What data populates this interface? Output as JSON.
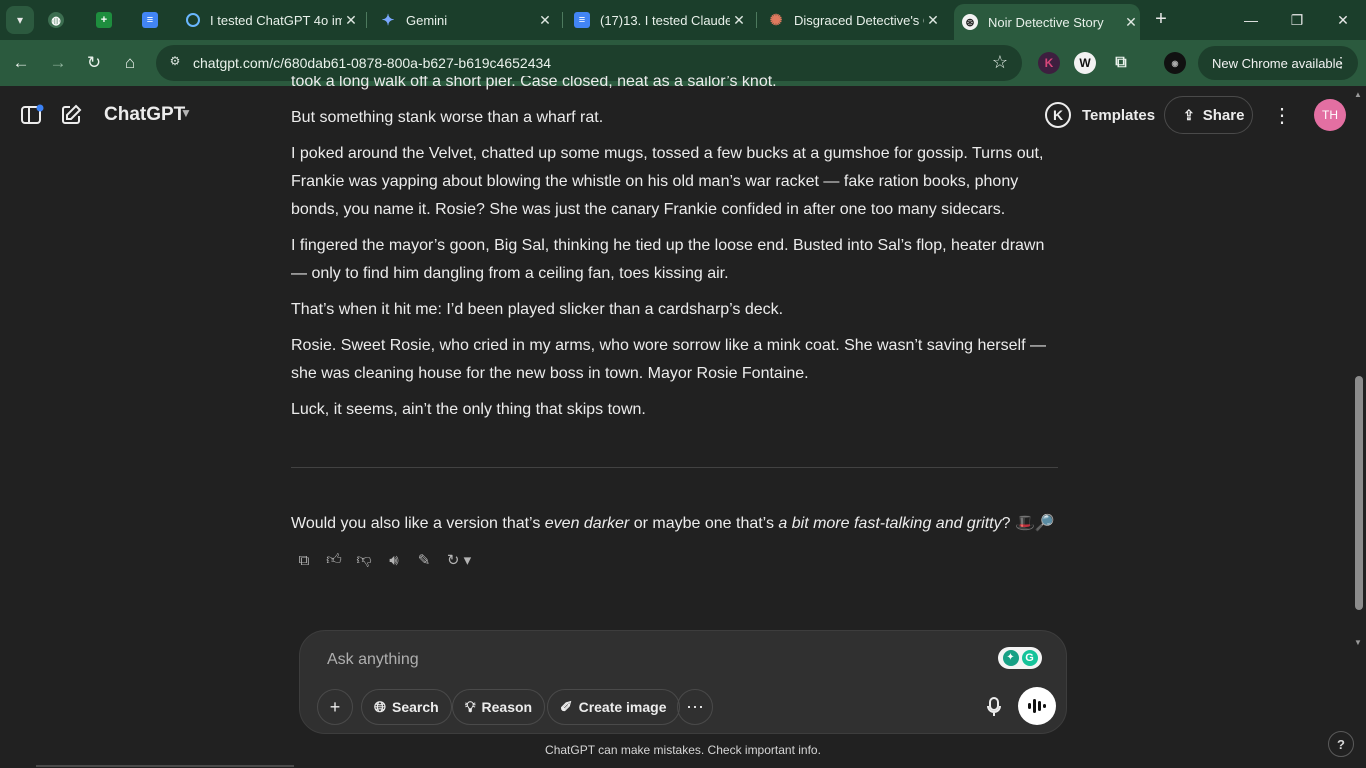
{
  "browser": {
    "tabs": [
      {
        "title": "",
        "favicon": "globe-icon"
      },
      {
        "title": "",
        "favicon": "sheets-icon"
      },
      {
        "title": "",
        "favicon": "docs-icon"
      },
      {
        "title": "I tested ChatGPT 4o im",
        "favicon": "refresh-favicon"
      },
      {
        "title": "Gemini",
        "favicon": "gemini-icon"
      },
      {
        "title": "(17)13. I tested Claude",
        "favicon": "docs-icon"
      },
      {
        "title": "Disgraced Detective's C",
        "favicon": "claude-icon"
      },
      {
        "title": "Noir Detective Story",
        "favicon": "chatgpt-icon"
      }
    ],
    "url": "chatgpt.com/c/680dab61-0878-800a-b627-b619c4652434",
    "update_label": "New Chrome available",
    "colors": {
      "frame": "#1b3e2b",
      "toolbar": "#2b5a3e"
    }
  },
  "header": {
    "model": "ChatGPT",
    "templates_badge": "K",
    "templates_label": "Templates",
    "share_label": "Share",
    "avatar_initials": "TH"
  },
  "conversation": {
    "cut_line": "took a long walk off a short pier. Case closed, neat as a sailor’s knot.",
    "paragraphs": [
      "But something stank worse than a wharf rat.",
      "I poked around the Velvet, chatted up some mugs, tossed a few bucks at a gumshoe for gossip. Turns out, Frankie was yapping about blowing the whistle on his old man’s war racket — fake ration books, phony bonds, you name it. Rosie? She was just the canary Frankie confided in after one too many sidecars.",
      "I fingered the mayor’s goon, Big Sal, thinking he tied up the loose end. Busted into Sal’s flop, heater drawn — only to find him dangling from a ceiling fan, toes kissing air.",
      "That’s when it hit me: I’d been played slicker than a cardsharp’s deck.",
      "Rosie. Sweet Rosie, who cried in my arms, who wore sorrow like a mink coat. She wasn’t saving herself — she was cleaning house for the new boss in town. Mayor Rosie Fontaine.",
      "Luck, it seems, ain’t the only thing that skips town."
    ],
    "followup": {
      "part1": "Would you also like a version that’s ",
      "em1": "even darker",
      "part2": " or maybe one that’s ",
      "em2": "a bit more fast-talking and gritty",
      "part3": "? 🎩🔎"
    }
  },
  "composer": {
    "placeholder": "Ask anything",
    "search_label": "Search",
    "reason_label": "Reason",
    "create_image_label": "Create image"
  },
  "footer": {
    "disclaimer": "ChatGPT can make mistakes. Check important info.",
    "help": "?"
  }
}
